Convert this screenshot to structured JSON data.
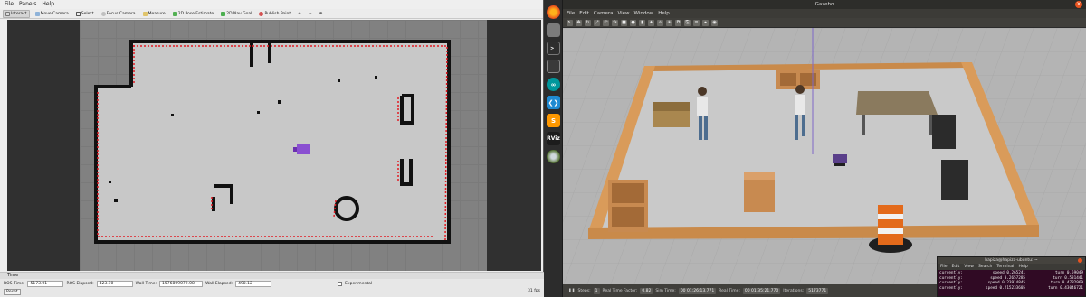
{
  "rviz": {
    "menu": [
      "File",
      "Panels",
      "Help"
    ],
    "tools": [
      {
        "label": "Interact",
        "icon": "cursor-icon",
        "active": true
      },
      {
        "label": "Move Camera",
        "icon": "camera-move-icon"
      },
      {
        "label": "Select",
        "icon": "select-icon"
      },
      {
        "label": "Focus Camera",
        "icon": "focus-icon"
      },
      {
        "label": "Measure",
        "icon": "measure-icon"
      },
      {
        "label": "2D Pose Estimate",
        "icon": "pose-estimate-icon"
      },
      {
        "label": "2D Nav Goal",
        "icon": "nav-goal-icon"
      },
      {
        "label": "Publish Point",
        "icon": "publish-point-icon"
      }
    ],
    "extra_tools": [
      "+",
      "−",
      "⊕"
    ],
    "time": {
      "panel_title": "Time",
      "ros_time_label": "ROS Time:",
      "ros_time": "5173.01",
      "ros_elapsed_label": "ROS Elapsed:",
      "ros_elapsed": "423.10",
      "wall_time_label": "Wall Time:",
      "wall_time": "1576809072.08",
      "wall_elapsed_label": "Wall Elapsed:",
      "wall_elapsed": "498.12",
      "experimental_label": "Experimental",
      "reset_label": "Reset",
      "fps": "31 fps"
    }
  },
  "dock": {
    "icons": [
      "firefox-icon",
      "files-icon",
      "terminal-icon",
      "monitor-icon",
      "arduino-icon",
      "vscode-icon",
      "sublime-icon",
      "rviz-icon",
      "gazebo-icon"
    ],
    "rviz_label": "RViz"
  },
  "gazebo": {
    "window_title": "Gazebo",
    "menu": [
      "File",
      "Edit",
      "Camera",
      "View",
      "Window",
      "Help"
    ],
    "status": {
      "steps_label": "Steps:",
      "steps": "1",
      "rtf_label": "Real Time Factor:",
      "rtf": "0.82",
      "sim_time_label": "Sim Time:",
      "sim_time": "00 01:26:13.771",
      "real_time_label": "Real Time:",
      "real_time": "00 01:35:21.770",
      "iterations_label": "Iterations:",
      "iterations": "5173771"
    }
  },
  "terminal": {
    "title": "hapiza@hapiza-ubuntu: ~",
    "menu": [
      "File",
      "Edit",
      "View",
      "Search",
      "Terminal",
      "Help"
    ],
    "lines": [
      {
        "left": "currently:",
        "mid": "speed 0.265241",
        "right": "turn 0.59049"
      },
      {
        "left": "currently:",
        "mid": "speed 0.2657285",
        "right": "turn 0.531441"
      },
      {
        "left": "currently:",
        "mid": "speed 0.23914845",
        "right": "turn 0.4782969"
      },
      {
        "left": "currently:",
        "mid": "speed 0.215233605",
        "right": "turn 0.43046721"
      }
    ]
  },
  "colors": {
    "rviz_bg": "#ededed",
    "map_free": "#c8c8c8",
    "map_wall": "#111111",
    "laser_scan": "#e31b23",
    "robot": "#8a4fd1",
    "ubuntu_orange": "#e95420",
    "terminal_bg": "#300a24"
  }
}
